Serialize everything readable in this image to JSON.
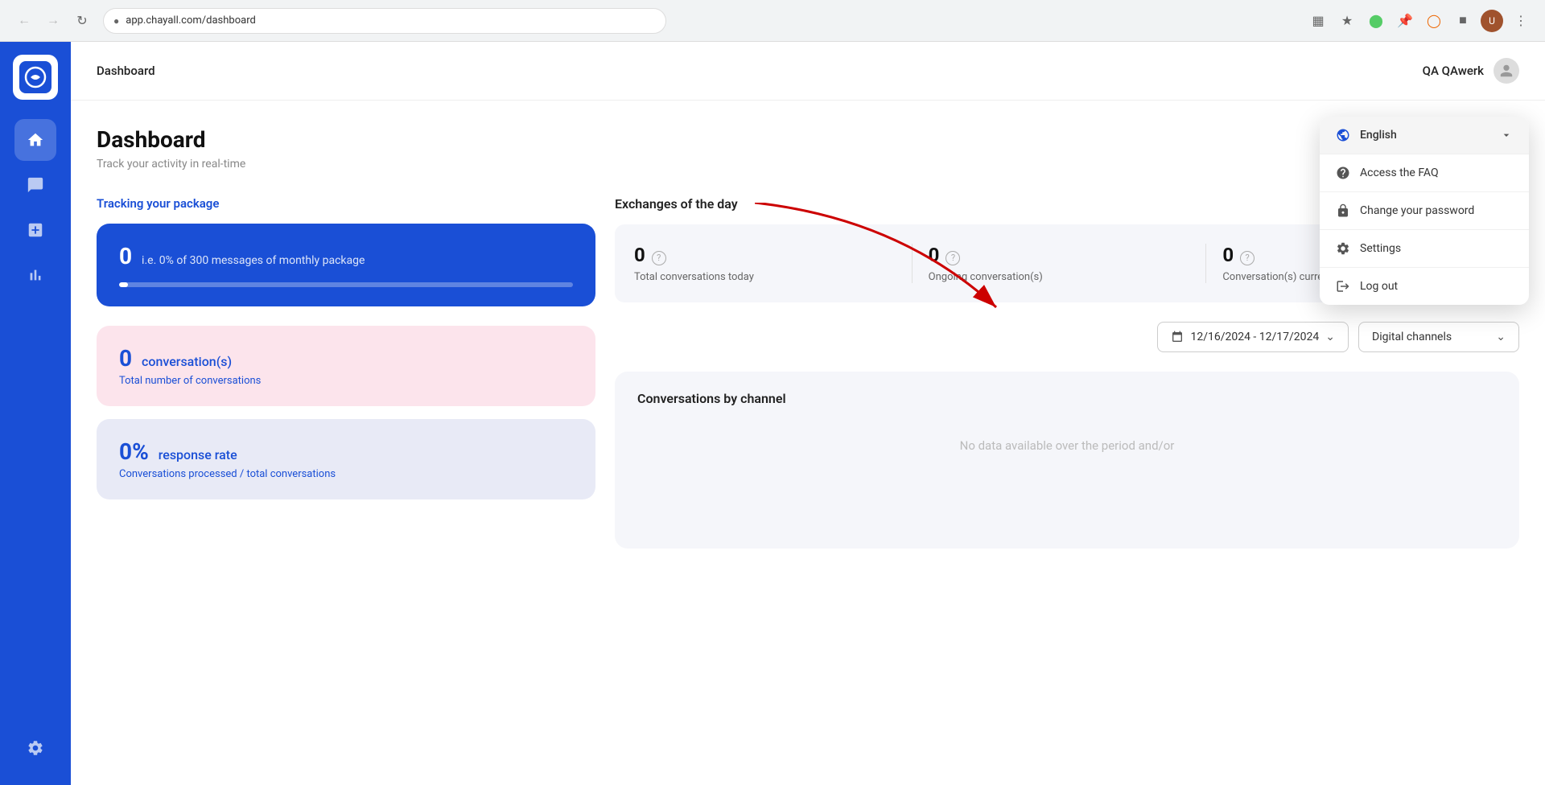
{
  "browser": {
    "url": "app.chayall.com/dashboard",
    "back_disabled": true,
    "forward_disabled": true
  },
  "header": {
    "title": "Dashboard",
    "user_name": "QA QAwerk"
  },
  "sidebar": {
    "logo_text": "C",
    "items": [
      {
        "id": "home",
        "icon": "🏠",
        "active": true
      },
      {
        "id": "chat",
        "icon": "💬",
        "active": false
      },
      {
        "id": "add",
        "icon": "➕",
        "active": false
      },
      {
        "id": "stats",
        "icon": "📊",
        "active": false
      },
      {
        "id": "settings",
        "icon": "⚙️",
        "active": false
      }
    ]
  },
  "dashboard": {
    "title": "Dashboard",
    "subtitle": "Track your activity in real-time",
    "tracking": {
      "label": "Tracking your package",
      "number": "0",
      "description": "i.e. 0% of 300 messages of monthly package",
      "progress_percent": 0
    },
    "exchanges": {
      "title": "Exchanges of the day",
      "stats": [
        {
          "value": "0",
          "label": "Total conversations today"
        },
        {
          "value": "0",
          "label": "Ongoing conversation(s)"
        },
        {
          "value": "0",
          "label": "Conversation(s) currently overdue"
        }
      ]
    },
    "filters": {
      "date_range": "12/16/2024 - 12/17/2024",
      "channel": "Digital channels"
    },
    "stat_cards": [
      {
        "type": "pink",
        "number": "0",
        "label_inline": "conversation(s)",
        "sublabel": "Total number of conversations"
      },
      {
        "type": "blue",
        "number": "0%",
        "label_inline": "response rate",
        "sublabel": "Conversations processed / total conversations"
      }
    ],
    "channel_section": {
      "title": "Conversations by channel",
      "empty_text": "No data available over the period and/or"
    }
  },
  "dropdown": {
    "visible": true,
    "items": [
      {
        "id": "language",
        "icon": "globe",
        "label": "English",
        "type": "language",
        "chevron": true
      },
      {
        "id": "faq",
        "icon": "info-circle",
        "label": "Access the FAQ"
      },
      {
        "id": "password",
        "icon": "lock",
        "label": "Change your password"
      },
      {
        "id": "settings",
        "icon": "gear",
        "label": "Settings"
      },
      {
        "id": "logout",
        "icon": "door",
        "label": "Log out"
      }
    ]
  }
}
